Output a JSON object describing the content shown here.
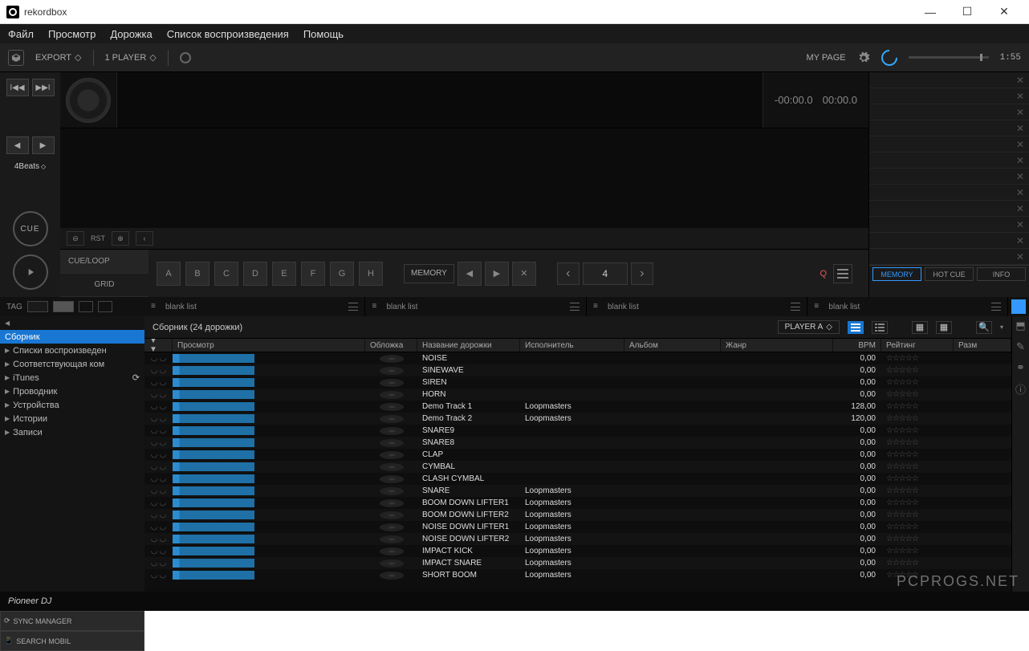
{
  "window": {
    "title": "rekordbox"
  },
  "menu": [
    "Файл",
    "Просмотр",
    "Дорожка",
    "Список воспроизведения",
    "Помощь"
  ],
  "toolbar": {
    "mode": "EXPORT",
    "players": "1 PLAYER",
    "mypage": "MY PAGE",
    "clock": "1:55"
  },
  "transport": {
    "beats": "4Beats",
    "cue": "CUE"
  },
  "deck": {
    "time_neg": "-00:00.0",
    "time_pos": "00:00.0",
    "rst": "RST"
  },
  "cue_panel": {
    "tab_cue": "CUE/LOOP",
    "tab_grid": "GRID",
    "hotcues": [
      "A",
      "B",
      "C",
      "D",
      "E",
      "F",
      "G",
      "H"
    ],
    "memory": "MEMORY",
    "loop_val": "4"
  },
  "right_tabs": {
    "memory": "MEMORY",
    "hotcue": "HOT CUE",
    "info": "INFO"
  },
  "tag_bar": {
    "label": "TAG"
  },
  "blank": "blank list",
  "tree": {
    "items": [
      "Сборник",
      "Списки воспроизведен",
      "Соответствующая ком",
      "iTunes",
      "Проводник",
      "Устройства",
      "Истории",
      "Записи"
    ],
    "sync_mgr": "SYNC MANAGER",
    "search_mobile": "SEARCH MOBIL"
  },
  "tracks_header": {
    "title": "Сборник (24 дорожки)",
    "player": "PLAYER A"
  },
  "columns": {
    "preview": "Просмотр",
    "art": "Обложка",
    "title": "Название дорожки",
    "artist": "Исполнитель",
    "album": "Альбом",
    "genre": "Жанр",
    "bpm": "BPM",
    "rating": "Рейтинг",
    "size": "Разм"
  },
  "rows": [
    {
      "title": "NOISE",
      "artist": "",
      "bpm": "0,00"
    },
    {
      "title": "SINEWAVE",
      "artist": "",
      "bpm": "0,00"
    },
    {
      "title": "SIREN",
      "artist": "",
      "bpm": "0,00"
    },
    {
      "title": "HORN",
      "artist": "",
      "bpm": "0,00"
    },
    {
      "title": "Demo Track 1",
      "artist": "Loopmasters",
      "bpm": "128,00"
    },
    {
      "title": "Demo Track 2",
      "artist": "Loopmasters",
      "bpm": "120,00"
    },
    {
      "title": "SNARE9",
      "artist": "",
      "bpm": "0,00"
    },
    {
      "title": "SNARE8",
      "artist": "",
      "bpm": "0,00"
    },
    {
      "title": "CLAP",
      "artist": "",
      "bpm": "0,00"
    },
    {
      "title": "CYMBAL",
      "artist": "",
      "bpm": "0,00"
    },
    {
      "title": "CLASH CYMBAL",
      "artist": "",
      "bpm": "0,00"
    },
    {
      "title": "SNARE",
      "artist": "Loopmasters",
      "bpm": "0,00"
    },
    {
      "title": "BOOM DOWN LIFTER1",
      "artist": "Loopmasters",
      "bpm": "0,00"
    },
    {
      "title": "BOOM DOWN LIFTER2",
      "artist": "Loopmasters",
      "bpm": "0,00"
    },
    {
      "title": "NOISE DOWN LIFTER1",
      "artist": "Loopmasters",
      "bpm": "0,00"
    },
    {
      "title": "NOISE DOWN LIFTER2",
      "artist": "Loopmasters",
      "bpm": "0,00"
    },
    {
      "title": "IMPACT KICK",
      "artist": "Loopmasters",
      "bpm": "0,00"
    },
    {
      "title": "IMPACT SNARE",
      "artist": "Loopmasters",
      "bpm": "0,00"
    },
    {
      "title": "SHORT BOOM",
      "artist": "Loopmasters",
      "bpm": "0,00"
    }
  ],
  "footer": {
    "brand": "Pioneer DJ"
  },
  "watermark": "PCPROGS.NET"
}
